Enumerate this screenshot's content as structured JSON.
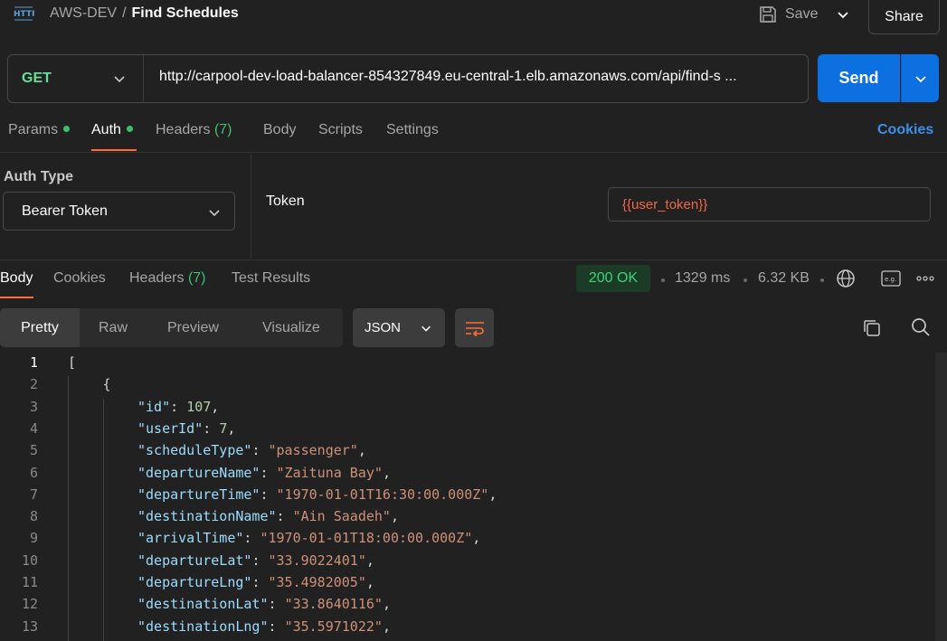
{
  "header": {
    "collection": "AWS-DEV",
    "separator": "/",
    "request_name": "Find Schedules",
    "save_label": "Save",
    "share_label": "Share"
  },
  "request": {
    "method": "GET",
    "url": "http://carpool-dev-load-balancer-854327849.eu-central-1.elb.amazonaws.com/api/find-s ...",
    "send_label": "Send"
  },
  "request_tabs": [
    {
      "label": "Params",
      "dot": true
    },
    {
      "label": "Auth",
      "dot": true,
      "active": true
    },
    {
      "label": "Headers",
      "count": "(7)"
    },
    {
      "label": "Body"
    },
    {
      "label": "Scripts"
    },
    {
      "label": "Settings"
    }
  ],
  "cookies_label": "Cookies",
  "auth": {
    "type_label": "Auth Type",
    "type_value": "Bearer Token",
    "token_label": "Token",
    "token_value": "{{user_token}}"
  },
  "response_tabs": [
    {
      "label": "Body",
      "active": true
    },
    {
      "label": "Cookies"
    },
    {
      "label": "Headers",
      "count": "(7)"
    },
    {
      "label": "Test Results"
    }
  ],
  "response_meta": {
    "status": "200 OK",
    "time": "1329 ms",
    "size": "6.32 KB"
  },
  "view_options": [
    "Pretty",
    "Raw",
    "Preview",
    "Visualize"
  ],
  "format": "JSON",
  "colors": {
    "accent": "#ff6c37",
    "send": "#0c70e0",
    "method": "#6bdd9a",
    "status_bg": "#1b3b26",
    "status_fg": "#3cd47a",
    "json_key": "#9cdcfe",
    "json_string": "#ce9178",
    "json_number": "#b5cea8"
  },
  "icons": [
    "http-icon",
    "save-icon",
    "chevron-down-icon",
    "globe-icon",
    "example-icon",
    "more-icon",
    "wrap-icon",
    "copy-icon",
    "search-icon"
  ],
  "code_lines": [
    {
      "num": "1",
      "indent": 0,
      "parts": [
        {
          "t": "[",
          "c": "p"
        }
      ]
    },
    {
      "num": "2",
      "indent": 1,
      "parts": [
        {
          "t": "{",
          "c": "p"
        }
      ]
    },
    {
      "num": "3",
      "indent": 2,
      "parts": [
        {
          "t": "\"id\"",
          "c": "k"
        },
        {
          "t": ": ",
          "c": "p"
        },
        {
          "t": "107",
          "c": "n"
        },
        {
          "t": ",",
          "c": "p"
        }
      ]
    },
    {
      "num": "4",
      "indent": 2,
      "parts": [
        {
          "t": "\"userId\"",
          "c": "k"
        },
        {
          "t": ": ",
          "c": "p"
        },
        {
          "t": "7",
          "c": "n"
        },
        {
          "t": ",",
          "c": "p"
        }
      ]
    },
    {
      "num": "5",
      "indent": 2,
      "parts": [
        {
          "t": "\"scheduleType\"",
          "c": "k"
        },
        {
          "t": ": ",
          "c": "p"
        },
        {
          "t": "\"passenger\"",
          "c": "s"
        },
        {
          "t": ",",
          "c": "p"
        }
      ]
    },
    {
      "num": "6",
      "indent": 2,
      "parts": [
        {
          "t": "\"departureName\"",
          "c": "k"
        },
        {
          "t": ": ",
          "c": "p"
        },
        {
          "t": "\"Zaituna Bay\"",
          "c": "s"
        },
        {
          "t": ",",
          "c": "p"
        }
      ]
    },
    {
      "num": "7",
      "indent": 2,
      "parts": [
        {
          "t": "\"departureTime\"",
          "c": "k"
        },
        {
          "t": ": ",
          "c": "p"
        },
        {
          "t": "\"1970-01-01T16:30:00.000Z\"",
          "c": "s"
        },
        {
          "t": ",",
          "c": "p"
        }
      ]
    },
    {
      "num": "8",
      "indent": 2,
      "parts": [
        {
          "t": "\"destinationName\"",
          "c": "k"
        },
        {
          "t": ": ",
          "c": "p"
        },
        {
          "t": "\"Ain Saadeh\"",
          "c": "s"
        },
        {
          "t": ",",
          "c": "p"
        }
      ]
    },
    {
      "num": "9",
      "indent": 2,
      "parts": [
        {
          "t": "\"arrivalTime\"",
          "c": "k"
        },
        {
          "t": ": ",
          "c": "p"
        },
        {
          "t": "\"1970-01-01T18:00:00.000Z\"",
          "c": "s"
        },
        {
          "t": ",",
          "c": "p"
        }
      ]
    },
    {
      "num": "10",
      "indent": 2,
      "parts": [
        {
          "t": "\"departureLat\"",
          "c": "k"
        },
        {
          "t": ": ",
          "c": "p"
        },
        {
          "t": "\"33.9022401\"",
          "c": "s"
        },
        {
          "t": ",",
          "c": "p"
        }
      ]
    },
    {
      "num": "11",
      "indent": 2,
      "parts": [
        {
          "t": "\"departureLng\"",
          "c": "k"
        },
        {
          "t": ": ",
          "c": "p"
        },
        {
          "t": "\"35.4982005\"",
          "c": "s"
        },
        {
          "t": ",",
          "c": "p"
        }
      ]
    },
    {
      "num": "12",
      "indent": 2,
      "parts": [
        {
          "t": "\"destinationLat\"",
          "c": "k"
        },
        {
          "t": ": ",
          "c": "p"
        },
        {
          "t": "\"33.8640116\"",
          "c": "s"
        },
        {
          "t": ",",
          "c": "p"
        }
      ]
    },
    {
      "num": "13",
      "indent": 2,
      "parts": [
        {
          "t": "\"destinationLng\"",
          "c": "k"
        },
        {
          "t": ": ",
          "c": "p"
        },
        {
          "t": "\"35.5971022\"",
          "c": "s"
        },
        {
          "t": ",",
          "c": "p"
        }
      ]
    }
  ]
}
